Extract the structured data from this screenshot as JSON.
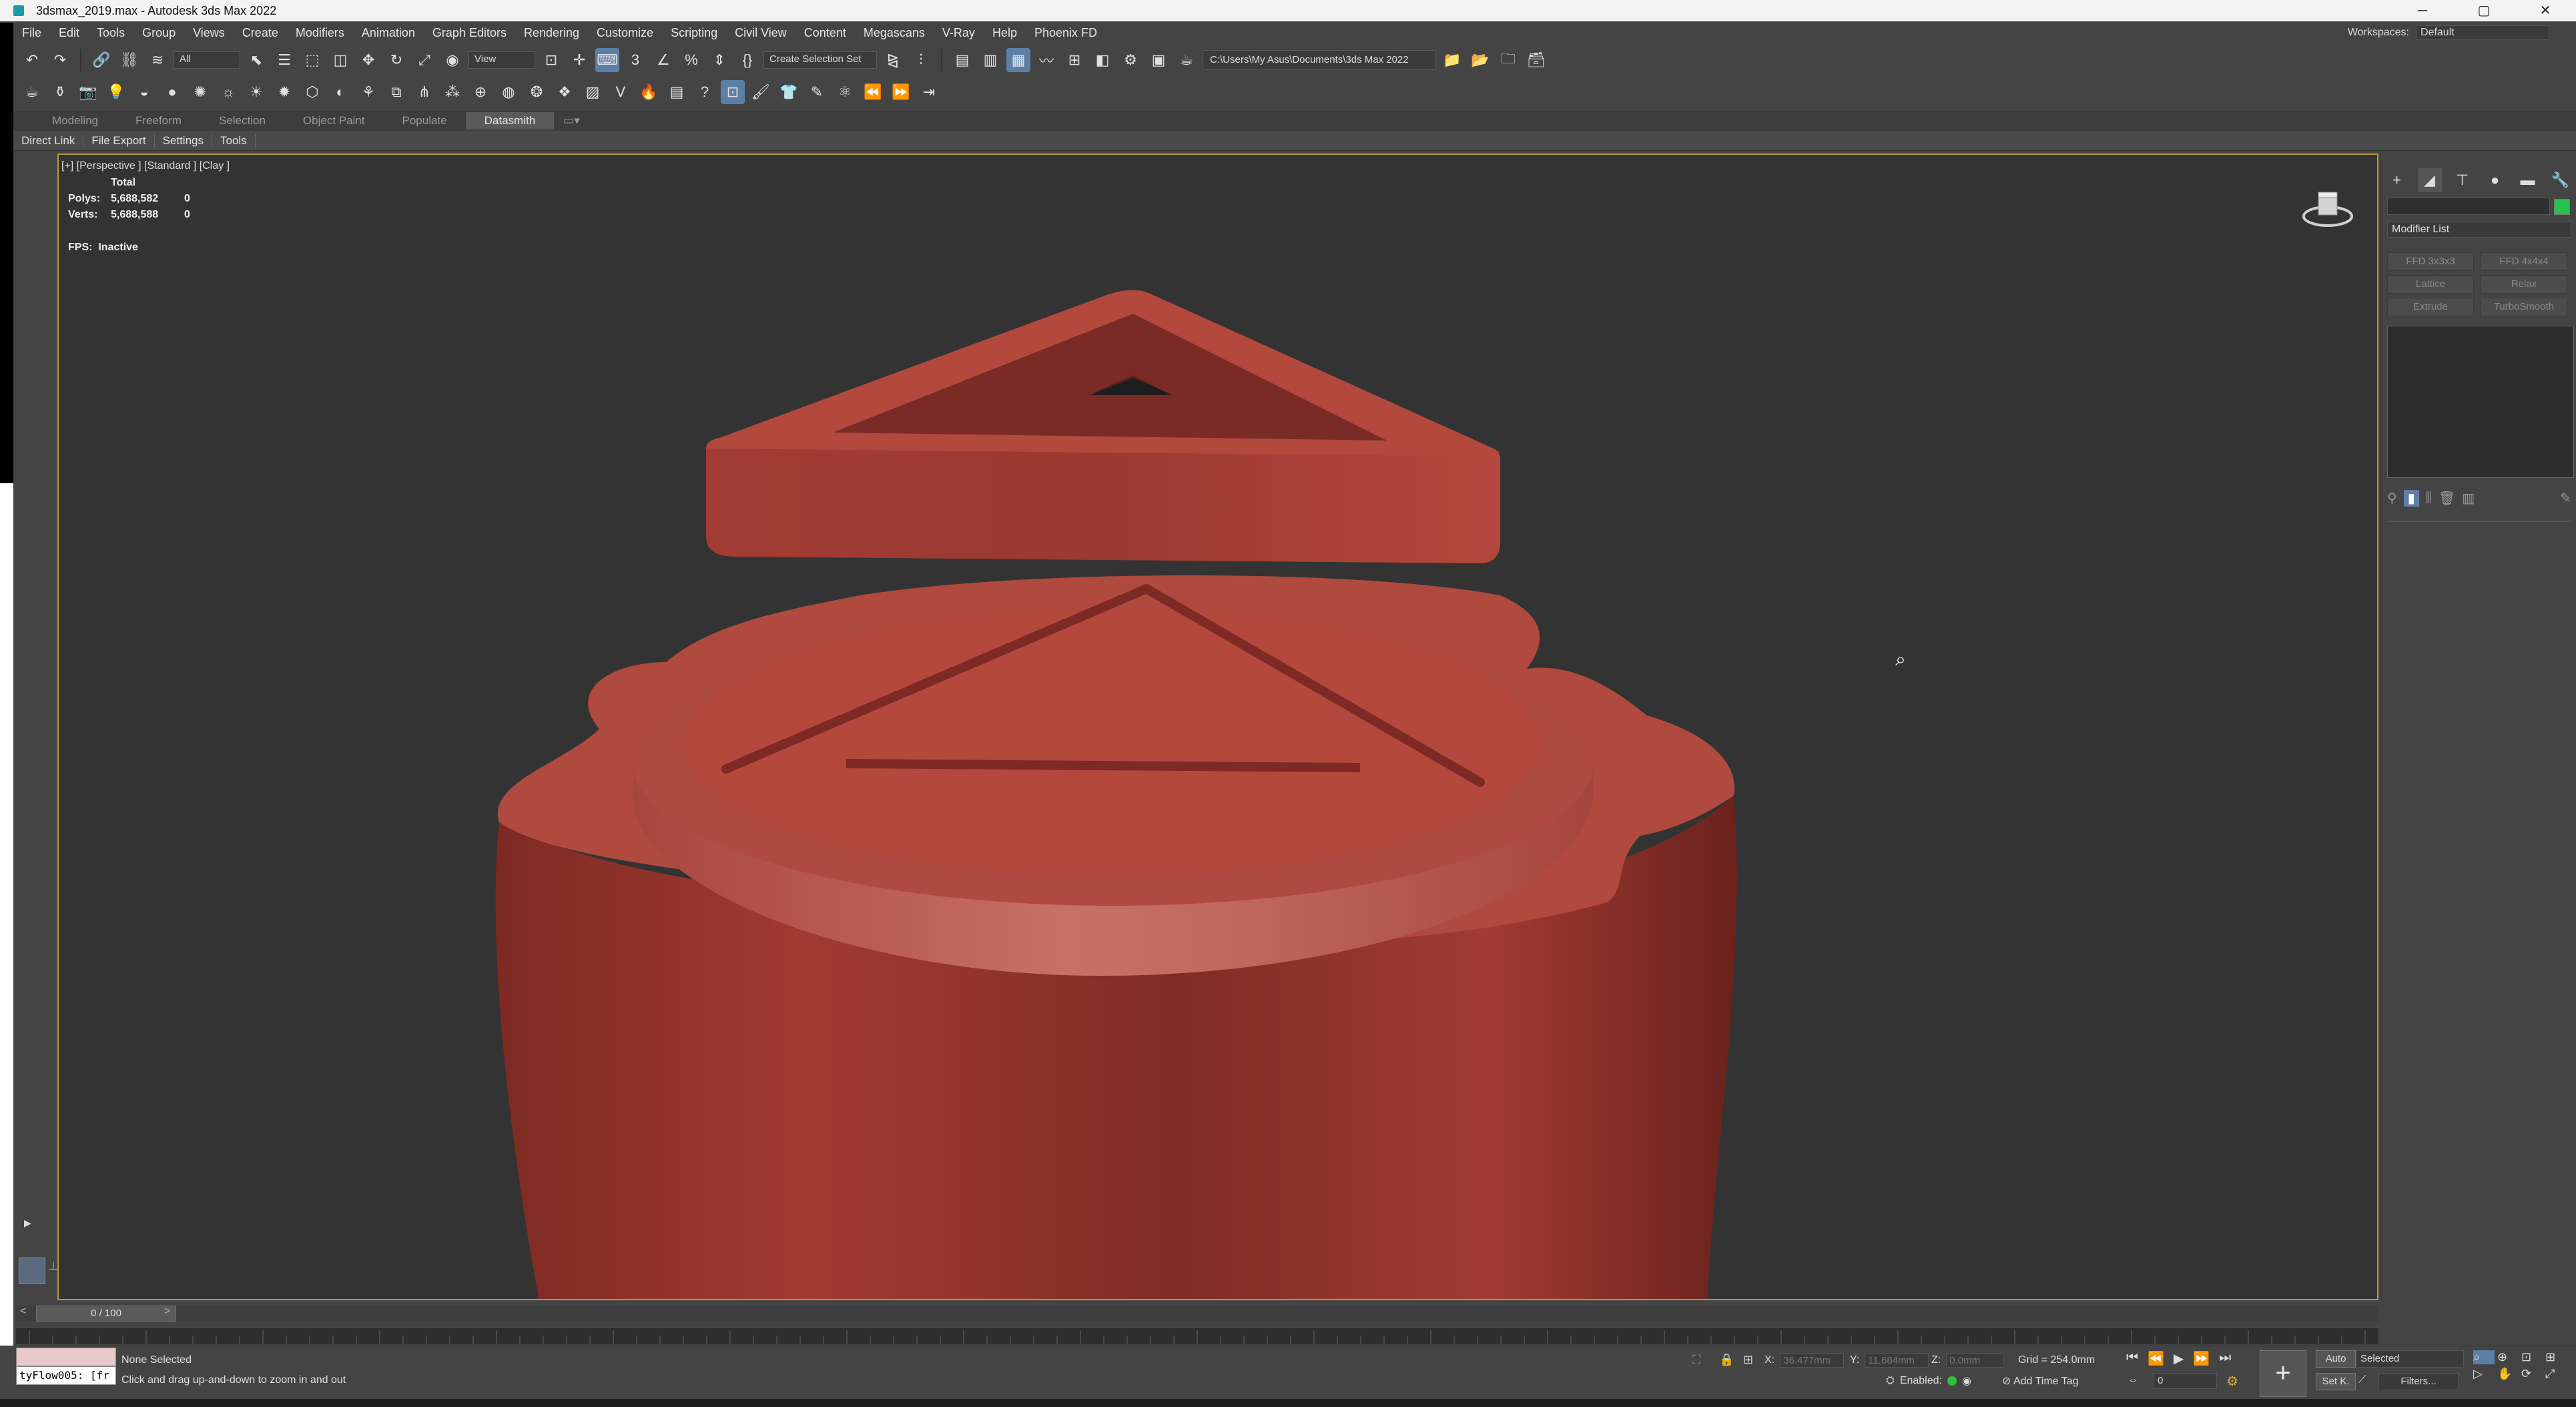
{
  "window": {
    "title": "3dsmax_2019.max - Autodesk 3ds Max 2022",
    "controls": [
      "─",
      "▢",
      "✕"
    ]
  },
  "menu": [
    "File",
    "Edit",
    "Tools",
    "Group",
    "Views",
    "Create",
    "Modifiers",
    "Animation",
    "Graph Editors",
    "Rendering",
    "Customize",
    "Scripting",
    "Civil View",
    "Content",
    "Megascans",
    "V-Ray",
    "Help",
    "Phoenix FD"
  ],
  "workspace": {
    "label": "Workspaces:",
    "value": "Default"
  },
  "toolbar1": {
    "selection_filter": "All",
    "ref_coord": "View",
    "named_selection": "Create Selection Set",
    "project_path": "C:\\Users\\My Asus\\Documents\\3ds Max 2022"
  },
  "ribbon_tabs": [
    "Modeling",
    "Freeform",
    "Selection",
    "Object Paint",
    "Populate",
    "Datasmith"
  ],
  "ribbon_active": "Datasmith",
  "subtabs": [
    "Direct Link",
    "File Export",
    "Settings",
    "Tools"
  ],
  "viewport": {
    "label": "[+] [Perspective ] [Standard ] [Clay ]",
    "stats_header": "Total",
    "polys_label": "Polys:",
    "polys_total": "5,688,582",
    "polys_sel": "0",
    "verts_label": "Verts:",
    "verts_total": "5,688,588",
    "verts_sel": "0",
    "fps_label": "FPS:",
    "fps_value": "Inactive"
  },
  "command_panel": {
    "modifier_list": "Modifier List",
    "buttons": [
      "FFD 3x3x3",
      "FFD 4x4x4",
      "Lattice",
      "Relax",
      "Extrude",
      "TurboSmooth"
    ]
  },
  "timeline": {
    "frame": "0 / 100"
  },
  "status": {
    "maxscript": "tyFlow005: [fr",
    "selection": "None Selected",
    "prompt": "Click and drag up-and-down to zoom in and out",
    "x_label": "X:",
    "x_value": "36.477mm",
    "y_label": "Y:",
    "y_value": "11.684mm",
    "z_label": "Z:",
    "z_value": "0.0mm",
    "grid": "Grid = 254.0mm",
    "enabled": "Enabled:",
    "add_time_tag": "Add Time Tag",
    "frame_value": "0",
    "auto": "Auto",
    "set_key": "Set K.",
    "selected": "Selected",
    "filters": "Filters..."
  },
  "colors": {
    "clay": "#b5453a",
    "viewport_bg": "#333333",
    "active_border": "#b89a33",
    "accent": "#5c7fa6"
  }
}
